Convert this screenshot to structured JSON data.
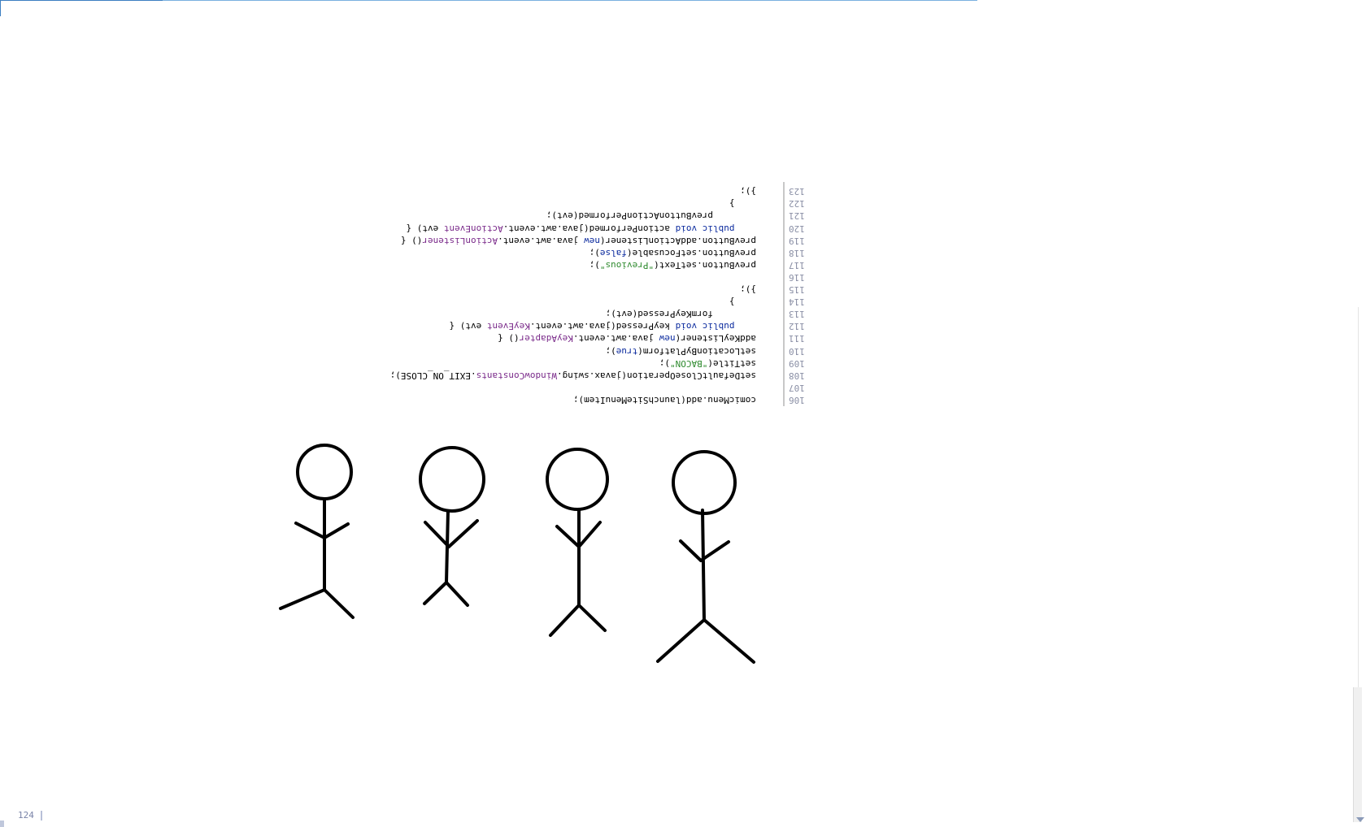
{
  "editor": {
    "lines": [
      {
        "num": "106",
        "parts": [
          [
            "",
            "comicMenu.add(launchSiteMenuItem);"
          ]
        ]
      },
      {
        "num": "107",
        "parts": []
      },
      {
        "num": "108",
        "parts": [
          [
            "",
            "setDefaultCloseOperation(javax.swing."
          ],
          [
            "cls",
            "WindowConstants"
          ],
          [
            "",
            ".EXIT_ON_CLOSE);"
          ]
        ]
      },
      {
        "num": "109",
        "parts": [
          [
            "",
            "setTitle("
          ],
          [
            "str",
            "\"BACON\""
          ],
          [
            "",
            ");"
          ]
        ]
      },
      {
        "num": "110",
        "parts": [
          [
            "",
            "setLocationByPlatform("
          ],
          [
            "kw",
            "true"
          ],
          [
            "",
            ");"
          ]
        ]
      },
      {
        "num": "111",
        "parts": [
          [
            "",
            "addKeyListener("
          ],
          [
            "kw",
            "new"
          ],
          [
            "",
            " java.awt.event."
          ],
          [
            "cls",
            "KeyAdapter"
          ],
          [
            "",
            "() {"
          ]
        ]
      },
      {
        "num": "112",
        "parts": [
          [
            "",
            "    "
          ],
          [
            "kw",
            "public void"
          ],
          [
            "",
            " keyPressed(java.awt.event."
          ],
          [
            "cls",
            "KeyEvent"
          ],
          [
            "",
            " evt) {"
          ]
        ]
      },
      {
        "num": "113",
        "parts": [
          [
            "",
            "        formKeyPressed(evt);"
          ]
        ]
      },
      {
        "num": "114",
        "parts": [
          [
            "",
            "    }"
          ]
        ]
      },
      {
        "num": "115",
        "parts": [
          [
            "",
            "});"
          ]
        ]
      },
      {
        "num": "116",
        "parts": []
      },
      {
        "num": "117",
        "parts": [
          [
            "",
            "prevButton.setText("
          ],
          [
            "str",
            "\"Previous\""
          ],
          [
            "",
            ");"
          ]
        ]
      },
      {
        "num": "118",
        "parts": [
          [
            "",
            "prevButton.setFocusable("
          ],
          [
            "kw",
            "false"
          ],
          [
            "",
            ");"
          ]
        ]
      },
      {
        "num": "119",
        "parts": [
          [
            "",
            "prevButton.addActionListener("
          ],
          [
            "kw",
            "new"
          ],
          [
            "",
            " java.awt.event."
          ],
          [
            "cls",
            "ActionListener"
          ],
          [
            "",
            "() {"
          ]
        ]
      },
      {
        "num": "120",
        "parts": [
          [
            "",
            "    "
          ],
          [
            "kw",
            "public void"
          ],
          [
            "",
            " actionPerformed(java.awt.event."
          ],
          [
            "cls",
            "ActionEvent"
          ],
          [
            "",
            " evt) {"
          ]
        ]
      },
      {
        "num": "121",
        "parts": [
          [
            "",
            "        prevButtonActionPerformed(evt);"
          ]
        ]
      },
      {
        "num": "122",
        "parts": [
          [
            "",
            "    }"
          ]
        ]
      },
      {
        "num": "123",
        "parts": [
          [
            "",
            "});"
          ]
        ]
      }
    ]
  },
  "drawing": {
    "figures": [
      "stick-figure-1",
      "stick-figure-2",
      "stick-figure-3",
      "stick-figure-4"
    ],
    "stroke_color": "#000000"
  },
  "status": {
    "line_number": "124"
  },
  "colors": {
    "keyword": "#0b2a9e",
    "string": "#2e8a2e",
    "class": "#7a2a8a",
    "line_number": "#8a8fa5"
  }
}
